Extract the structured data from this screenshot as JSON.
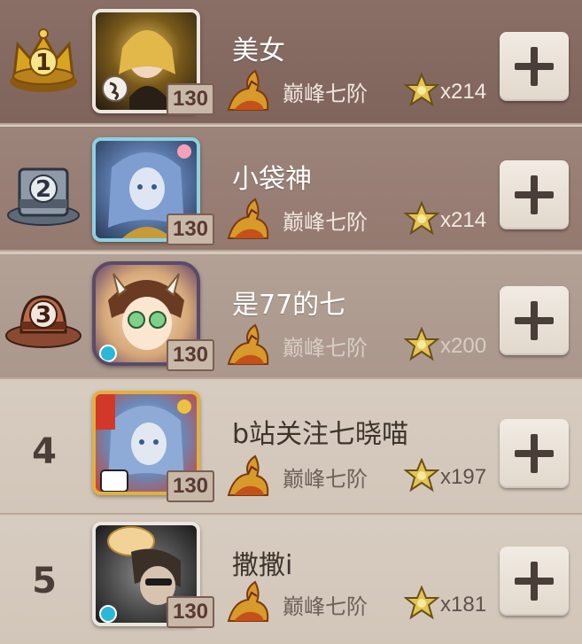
{
  "leaderboard": {
    "entries": [
      {
        "rank": "1",
        "name": "美女",
        "level": "130",
        "tier": "巅峰七阶",
        "stars": "x214",
        "rank_icon": "gold-crown-icon"
      },
      {
        "rank": "2",
        "name": "小袋神",
        "level": "130",
        "tier": "巅峰七阶",
        "stars": "x214",
        "rank_icon": "silver-top-hat-icon"
      },
      {
        "rank": "3",
        "name": "是77的七",
        "level": "130",
        "tier": "巅峰七阶",
        "stars": "x200",
        "rank_icon": "bronze-hat-icon"
      },
      {
        "rank": "4",
        "name": "b站关注七晓喵",
        "level": "130",
        "tier": "巅峰七阶",
        "stars": "x197"
      },
      {
        "rank": "5",
        "name": "撒撒i",
        "level": "130",
        "tier": "巅峰七阶",
        "stars": "x181"
      }
    ]
  },
  "colors": {
    "row1_bg": "#8a6f66",
    "row2_bg": "#9c847a",
    "row3_bg": "#b3a196",
    "row_default_bg": "#d7ccc0",
    "level_tag_text": "#5a3a33",
    "add_button": "#ece4da"
  }
}
